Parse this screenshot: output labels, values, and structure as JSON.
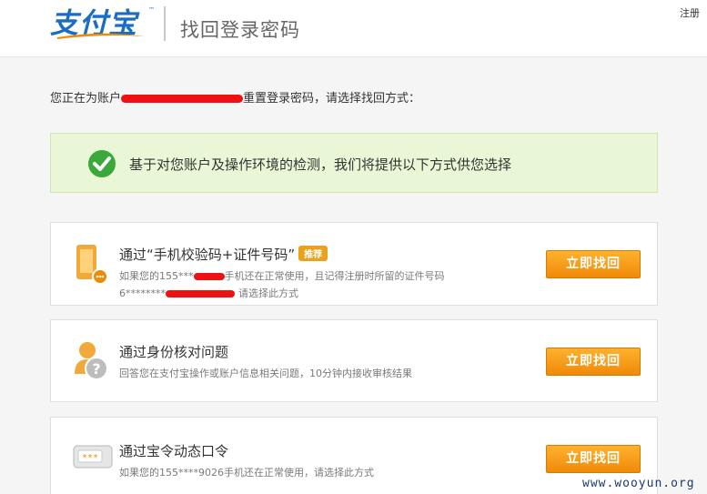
{
  "header": {
    "logo_text": "支付宝",
    "logo_tm": "™",
    "title": "找回登录密码",
    "register_label": "注册"
  },
  "account_line": {
    "prefix": "您正在为账户",
    "suffix": "重置登录密码，请选择找回方式："
  },
  "notice": {
    "text": "基于对您账户及操作环境的检测，我们将提供以下方式供您选择"
  },
  "options": [
    {
      "title": "通过“手机校验码+证件号码”",
      "badge": "推荐",
      "desc_prefix": "如果您的155***",
      "desc_suffix": "手机还在正常使用，且记得注册时所留的证件号码",
      "desc2_prefix": "6********",
      "desc2_suffix": "请选择此方式",
      "button": "立即找回"
    },
    {
      "title": "通过身份核对问题",
      "desc": "回答您在支付宝操作或账户信息相关问题，10分钟内接收审核结果",
      "button": "立即找回"
    },
    {
      "title": "通过宝令动态口令",
      "desc": "如果您的155****9026手机还在正常使用，请选择此方式",
      "button": "立即找回"
    }
  ],
  "watermark": "www.wooyun.org",
  "colors": {
    "brand_blue": "#1a6cc4",
    "button_orange": "#f39a12",
    "notice_bg": "#e9f7d6",
    "check_green": "#3aa83a",
    "redaction_red": "#ee1111"
  }
}
